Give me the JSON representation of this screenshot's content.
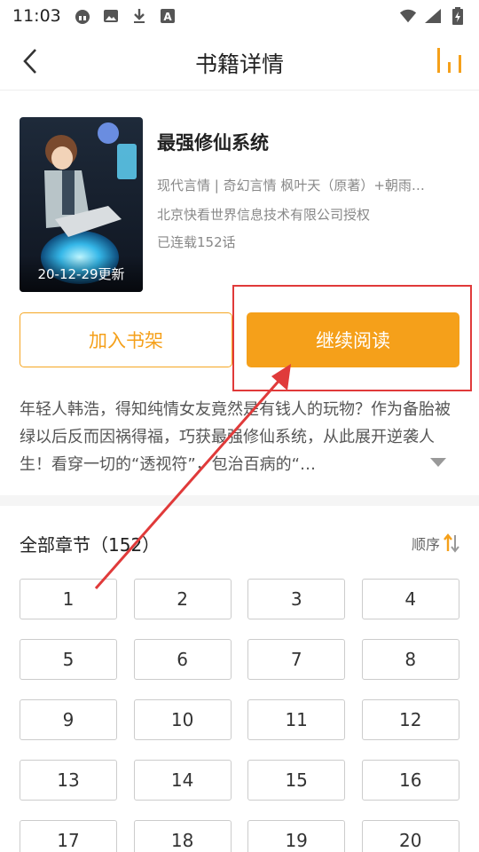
{
  "status_bar": {
    "time": "11:03",
    "left_icons": [
      "headset-icon",
      "image-icon",
      "download-icon",
      "a-icon"
    ],
    "right_icons": [
      "wifi-icon",
      "signal-icon",
      "battery-icon"
    ]
  },
  "nav": {
    "title": "书籍详情",
    "back_icon": "chevron-left-icon",
    "action_icon": "ranking-icon"
  },
  "book": {
    "title": "最强修仙系统",
    "genres_authors": "现代言情 | 奇幻言情   枫叶天（原著）+朝雨…",
    "license": "北京快看世界信息技术有限公司授权",
    "status": "已连载152话",
    "update_date": "20-12-29更新"
  },
  "actions": {
    "add_shelf": "加入书架",
    "continue_read": "继续阅读"
  },
  "description": "年轻人韩浩，得知纯情女友竟然是有钱人的玩物？作为备胎被绿以后反而因祸得福，巧获最强修仙系统，从此展开逆袭人生！看穿一切的“透视符”，包治百病的“…",
  "chapters": {
    "header": "全部章节（152）",
    "sort_label": "顺序",
    "items": [
      "1",
      "2",
      "3",
      "4",
      "5",
      "6",
      "7",
      "8",
      "9",
      "10",
      "11",
      "12",
      "13",
      "14",
      "15",
      "16",
      "17",
      "18",
      "19",
      "20"
    ]
  },
  "colors": {
    "accent": "#f5a01a",
    "annotation": "#e03a3a"
  }
}
